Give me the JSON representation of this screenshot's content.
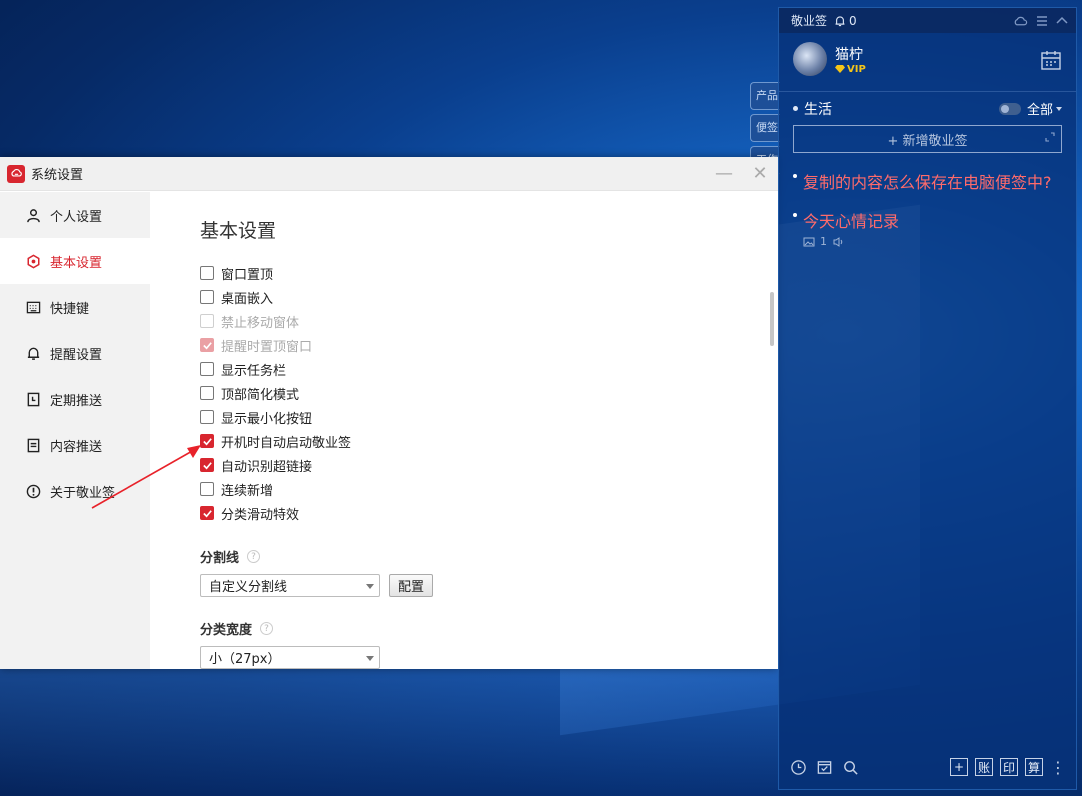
{
  "desktop": {
    "bg_tabs": [
      "产品",
      "便签",
      "工作"
    ]
  },
  "settings_window": {
    "title": "系统设置",
    "minimize_glyph": "—",
    "close_glyph": "✕",
    "sidebar": [
      {
        "label": "个人设置",
        "icon": "user-icon",
        "active": false
      },
      {
        "label": "基本设置",
        "icon": "gear-icon",
        "active": true
      },
      {
        "label": "快捷键",
        "icon": "keyboard-icon",
        "active": false
      },
      {
        "label": "提醒设置",
        "icon": "bell-icon",
        "active": false
      },
      {
        "label": "定期推送",
        "icon": "clock-doc-icon",
        "active": false
      },
      {
        "label": "内容推送",
        "icon": "document-icon",
        "active": false
      },
      {
        "label": "关于敬业签",
        "icon": "info-icon",
        "active": false
      }
    ],
    "content": {
      "heading": "基本设置",
      "options": [
        {
          "label": "窗口置顶",
          "checked": false,
          "disabled": false
        },
        {
          "label": "桌面嵌入",
          "checked": false,
          "disabled": false
        },
        {
          "label": "禁止移动窗体",
          "checked": false,
          "disabled": true
        },
        {
          "label": "提醒时置顶窗口",
          "checked": true,
          "disabled": true
        },
        {
          "label": "显示任务栏",
          "checked": false,
          "disabled": false
        },
        {
          "label": "顶部简化模式",
          "checked": false,
          "disabled": false
        },
        {
          "label": "显示最小化按钮",
          "checked": false,
          "disabled": false
        },
        {
          "label": "开机时自动启动敬业签",
          "checked": true,
          "disabled": false
        },
        {
          "label": "自动识别超链接",
          "checked": true,
          "disabled": false
        },
        {
          "label": "连续新增",
          "checked": false,
          "disabled": false
        },
        {
          "label": "分类滑动特效",
          "checked": true,
          "disabled": false
        }
      ],
      "divider_section": {
        "label": "分割线",
        "help": "?",
        "select_value": "自定义分割线",
        "config_button": "配置"
      },
      "width_section": {
        "label": "分类宽度",
        "help": "?",
        "select_value": "小（27px）"
      }
    }
  },
  "panel": {
    "app_name": "敬业签",
    "notification_count": "0",
    "user_name": "猫柠",
    "vip_label": "VIP",
    "category": "生活",
    "filter": "全部",
    "new_button": "+ 新增敬业签",
    "notes": [
      {
        "text": "复制的内容怎么保存在电脑便签中?",
        "meta": ""
      },
      {
        "text": "今天心情记录",
        "meta": "1"
      }
    ],
    "bottom_right_buttons": [
      "+",
      "账",
      "印",
      "算"
    ],
    "more_glyph": "⋮"
  },
  "colors": {
    "accent_red": "#d8262f",
    "note_red": "#ff6b6b",
    "panel_bg": "#06327a"
  }
}
